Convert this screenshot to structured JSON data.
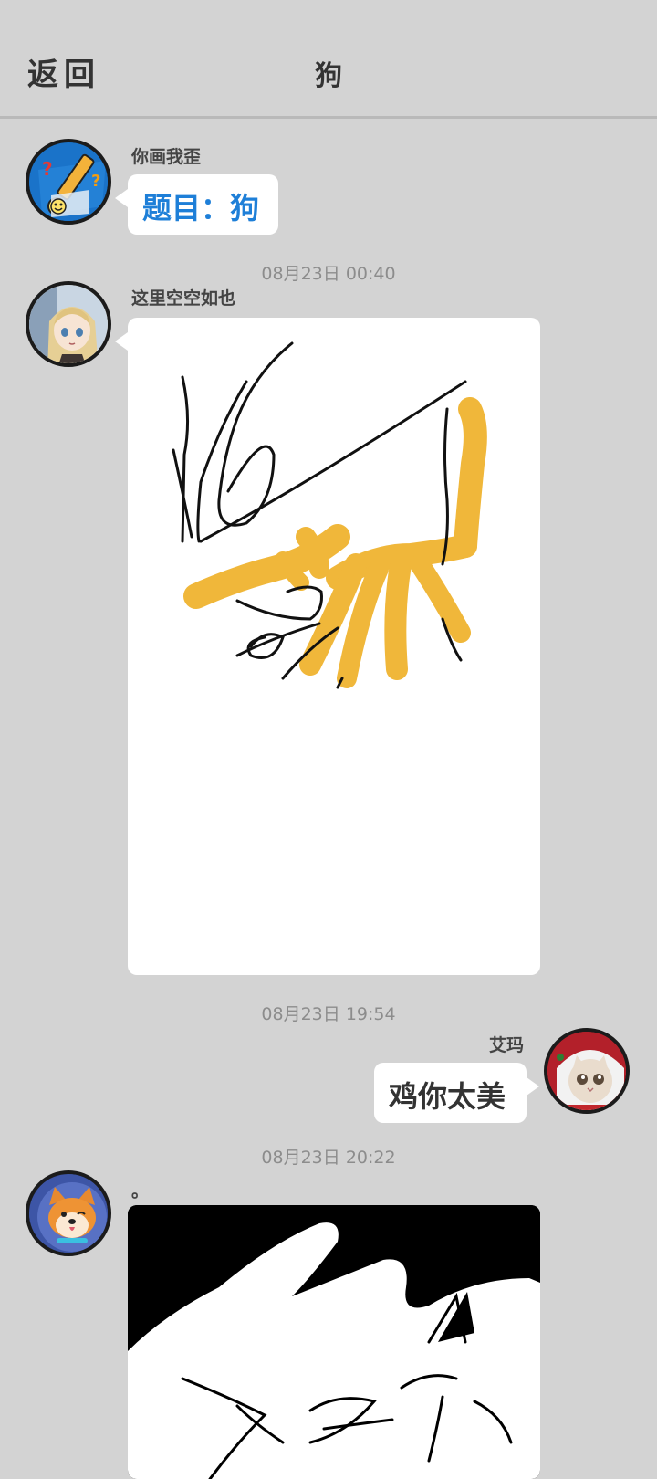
{
  "header": {
    "back_label": "返回",
    "title": "狗"
  },
  "colors": {
    "background": "#d3d3d3",
    "bubble": "#ffffff",
    "topic_text": "#1e7fd8",
    "drawing_orange": "#f0b73a"
  },
  "messages": [
    {
      "sender": "你画我歪",
      "side": "left",
      "type": "text",
      "text": "题目：狗",
      "avatar_icon": "pencil-game-icon"
    },
    {
      "timestamp": "08月23日  00:40",
      "sender": "这里空空如也",
      "side": "left",
      "type": "drawing",
      "avatar_icon": "anime-girl-icon"
    },
    {
      "timestamp": "08月23日  19:54",
      "sender": "艾玛",
      "side": "right",
      "type": "text",
      "text": "鸡你太美",
      "avatar_icon": "cat-avatar-icon"
    },
    {
      "timestamp": "08月23日  20:22",
      "sender": "。",
      "side": "left",
      "type": "drawing",
      "avatar_icon": "shiba-dog-icon"
    }
  ]
}
